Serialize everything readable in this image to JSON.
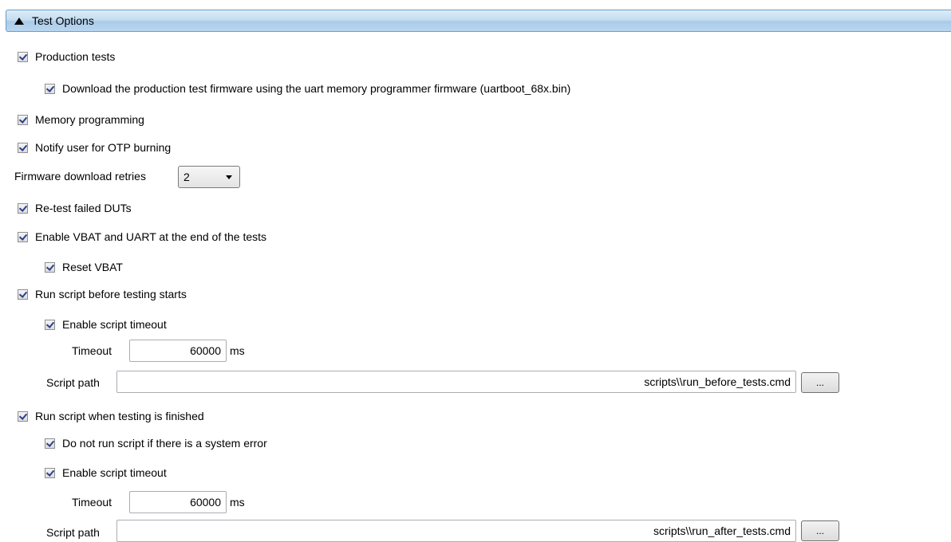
{
  "header": {
    "title": "Test Options"
  },
  "options": {
    "production_tests": "Production tests",
    "download_fw": "Download the production test firmware using the uart memory programmer firmware (uartboot_68x.bin)",
    "memory_programming": "Memory programming",
    "notify_otp": "Notify user for OTP burning",
    "retest_failed": "Re-test failed DUTs",
    "enable_vbat_uart": "Enable VBAT and UART at the end of the tests",
    "reset_vbat": "Reset VBAT",
    "run_before": "Run script before testing starts",
    "before_enable_timeout": "Enable script timeout",
    "run_after": "Run script when testing is finished",
    "after_no_run_on_error": "Do not run script if there is a system error",
    "after_enable_timeout": "Enable script timeout"
  },
  "fw_retries": {
    "label": "Firmware download retries",
    "value": "2"
  },
  "before_script": {
    "timeout_label": "Timeout",
    "timeout_value": "60000",
    "timeout_unit": "ms",
    "path_label": "Script path",
    "path_value": "scripts\\\\run_before_tests.cmd",
    "browse": "..."
  },
  "after_script": {
    "timeout_label": "Timeout",
    "timeout_value": "60000",
    "timeout_unit": "ms",
    "path_label": "Script path",
    "path_value": "scripts\\\\run_after_tests.cmd",
    "browse": "..."
  },
  "colors": {
    "header_border": "#6a9ec7",
    "header_bg": "#c3dcf0",
    "check": "#2a3f8f"
  }
}
